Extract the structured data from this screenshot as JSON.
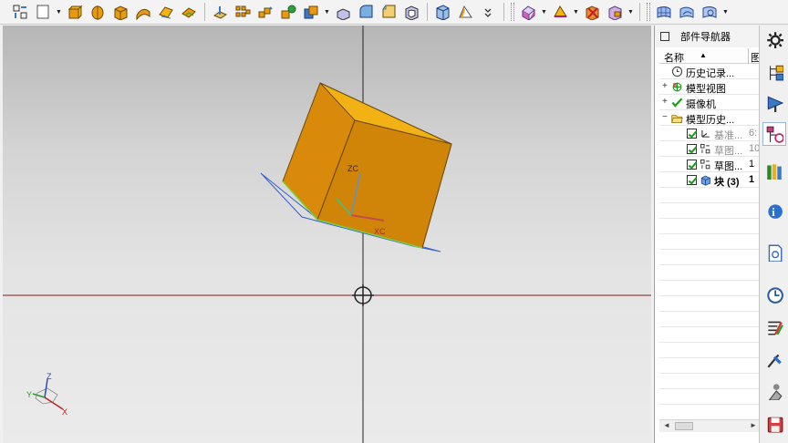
{
  "toolbar": {
    "groups": [
      [
        "sketch-icon",
        "new-file-icon",
        "drop",
        "extrude-icon",
        "revolve-icon",
        "block-icon",
        "sweep-icon",
        "surface-icon",
        "thicken-icon",
        "sep",
        "datum-plane-icon",
        "pattern-icon",
        "array-icon",
        "boolean-icon",
        "unite-icon",
        "drop",
        "trim-body-icon",
        "edge-blend-icon",
        "chamfer-icon",
        "shell-icon",
        "sep",
        "offset-face-icon",
        "draft-icon",
        "chevron-more-icon",
        "sep"
      ],
      [
        "grip",
        "mesh-icon",
        "drop",
        "edit-feature-icon",
        "drop",
        "move-object-icon",
        "replace-face-icon",
        "drop",
        "sep"
      ],
      [
        "grip",
        "surface-grid-icon",
        "surface-flow-icon",
        "surface-edit-icon",
        "drop"
      ]
    ],
    "colors": {
      "accent_orange": "#e89a10",
      "accent_blue": "#3a78c8"
    }
  },
  "viewport": {
    "background": "#d4d4d4",
    "cube_colors": {
      "front": "#d98a0a",
      "top": "#f4b414",
      "side": "#c97d08",
      "edge": "#6a4a08"
    },
    "datum_axis_labels": {
      "z": "ZC",
      "x": "XC"
    },
    "triad_labels": {
      "z": "Z",
      "x": "X",
      "y": "Y"
    }
  },
  "navigator": {
    "title": "部件导航器",
    "header": {
      "name": "名称",
      "sort": "▲",
      "col2": "图"
    },
    "rows": [
      {
        "expander": "",
        "icon": "clock-icon",
        "checked": false,
        "label": "历史记录...",
        "extra": "",
        "style": "normal"
      },
      {
        "expander": "+",
        "icon": "model-views-icon",
        "checked": false,
        "label": "模型视图",
        "extra": "",
        "style": "normal"
      },
      {
        "expander": "+",
        "icon": "camera-check-icon",
        "checked": false,
        "label": "摄像机",
        "extra": "",
        "style": "normal"
      },
      {
        "expander": "−",
        "icon": "folder-open-icon",
        "checked": false,
        "label": "模型历史...",
        "extra": "",
        "style": "normal"
      },
      {
        "expander": "",
        "icon": "datum-csys-icon",
        "checked": true,
        "label": "基准...",
        "extra": "6:",
        "style": "grey"
      },
      {
        "expander": "",
        "icon": "sketch-feature-icon",
        "checked": true,
        "label": "草图...",
        "extra": "10",
        "style": "grey"
      },
      {
        "expander": "",
        "icon": "sketch-feature-icon",
        "checked": true,
        "label": "草图...",
        "extra": "1",
        "style": "normal"
      },
      {
        "expander": "",
        "icon": "block-feature-icon",
        "checked": true,
        "label": "块 (3)",
        "extra": "1",
        "style": "bold"
      }
    ],
    "scroll": {
      "left": "◄",
      "right": "►"
    }
  },
  "resource_bar": {
    "items": [
      "gear-icon",
      "assembly-navigator-icon",
      "constraint-navigator-icon",
      "part-navigator-icon",
      "reuse-library-icon",
      "internet-explorer-icon",
      "document-icon",
      "history-icon",
      "visualization-icon",
      "system-materials-icon",
      "roles-icon",
      "save-icon"
    ]
  }
}
